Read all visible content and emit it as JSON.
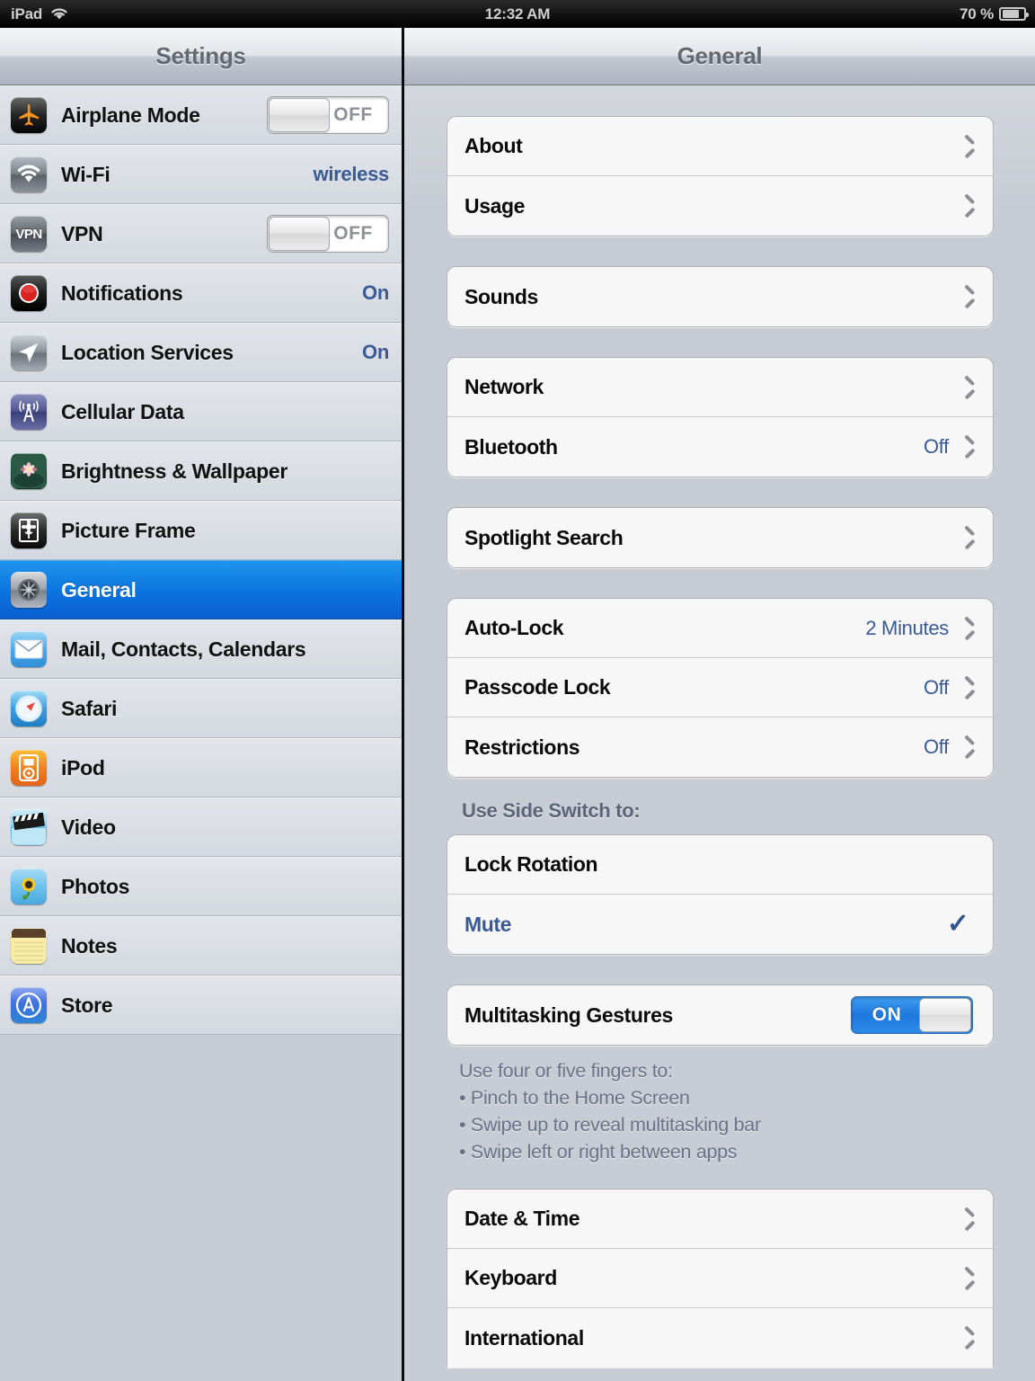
{
  "statusbar": {
    "device": "iPad",
    "wifi_icon": "wifi-icon",
    "time": "12:32 AM",
    "battery_percent": "70 %",
    "battery_icon": "battery-icon"
  },
  "sidebar": {
    "title": "Settings",
    "items": [
      {
        "label": "Airplane Mode",
        "icon": "airplane-icon",
        "control": "toggle",
        "state": "OFF",
        "selected": false
      },
      {
        "label": "Wi-Fi",
        "icon": "wifi-settings-icon",
        "control": "value",
        "value": "wireless",
        "selected": false
      },
      {
        "label": "VPN",
        "icon": "vpn-icon",
        "control": "toggle",
        "state": "OFF",
        "selected": false
      },
      {
        "label": "Notifications",
        "icon": "notifications-icon",
        "control": "value",
        "value": "On",
        "selected": false
      },
      {
        "label": "Location Services",
        "icon": "location-icon",
        "control": "value",
        "value": "On",
        "selected": false
      },
      {
        "label": "Cellular Data",
        "icon": "cellular-icon",
        "control": "none",
        "selected": false
      },
      {
        "label": "Brightness & Wallpaper",
        "icon": "wallpaper-icon",
        "control": "none",
        "selected": false
      },
      {
        "label": "Picture Frame",
        "icon": "picture-frame-icon",
        "control": "none",
        "selected": false
      },
      {
        "label": "General",
        "icon": "gear-icon",
        "control": "none",
        "selected": true
      },
      {
        "label": "Mail, Contacts, Calendars",
        "icon": "mail-icon",
        "control": "none",
        "selected": false
      },
      {
        "label": "Safari",
        "icon": "safari-icon",
        "control": "none",
        "selected": false
      },
      {
        "label": "iPod",
        "icon": "ipod-icon",
        "control": "none",
        "selected": false
      },
      {
        "label": "Video",
        "icon": "video-icon",
        "control": "none",
        "selected": false
      },
      {
        "label": "Photos",
        "icon": "photos-icon",
        "control": "none",
        "selected": false
      },
      {
        "label": "Notes",
        "icon": "notes-icon",
        "control": "none",
        "selected": false
      },
      {
        "label": "Store",
        "icon": "store-icon",
        "control": "none",
        "selected": false
      }
    ]
  },
  "main": {
    "title": "General",
    "groups": [
      {
        "rows": [
          {
            "label": "About",
            "value": "",
            "accessory": "chevron"
          },
          {
            "label": "Usage",
            "value": "",
            "accessory": "chevron"
          }
        ]
      },
      {
        "rows": [
          {
            "label": "Sounds",
            "value": "",
            "accessory": "chevron"
          }
        ]
      },
      {
        "rows": [
          {
            "label": "Network",
            "value": "",
            "accessory": "chevron"
          },
          {
            "label": "Bluetooth",
            "value": "Off",
            "accessory": "chevron"
          }
        ]
      },
      {
        "rows": [
          {
            "label": "Spotlight Search",
            "value": "",
            "accessory": "chevron"
          }
        ]
      },
      {
        "rows": [
          {
            "label": "Auto-Lock",
            "value": "2 Minutes",
            "accessory": "chevron"
          },
          {
            "label": "Passcode Lock",
            "value": "Off",
            "accessory": "chevron"
          },
          {
            "label": "Restrictions",
            "value": "Off",
            "accessory": "chevron"
          }
        ]
      },
      {
        "header": "Use Side Switch to:",
        "rows": [
          {
            "label": "Lock Rotation",
            "value": "",
            "accessory": "none",
            "style": "normal"
          },
          {
            "label": "Mute",
            "value": "",
            "accessory": "check",
            "style": "blue"
          }
        ]
      },
      {
        "rows": [
          {
            "label": "Multitasking Gestures",
            "value": "",
            "accessory": "toggle",
            "state": "ON"
          }
        ],
        "footer": "Use four or five fingers to:\n• Pinch to the Home Screen\n• Swipe up to reveal multitasking bar\n• Swipe left or right between apps"
      },
      {
        "partial": true,
        "rows": [
          {
            "label": "Date & Time",
            "value": "",
            "accessory": "chevron"
          },
          {
            "label": "Keyboard",
            "value": "",
            "accessory": "chevron"
          },
          {
            "label": "International",
            "value": "",
            "accessory": "chevron"
          }
        ]
      }
    ]
  },
  "colors": {
    "accent_blue": "#0c74e0",
    "value_blue": "#3a5a93",
    "toggle_on": "#2e8cea",
    "panel_bg": "#c8ccd4",
    "row_bg": "#f7f7f7"
  }
}
